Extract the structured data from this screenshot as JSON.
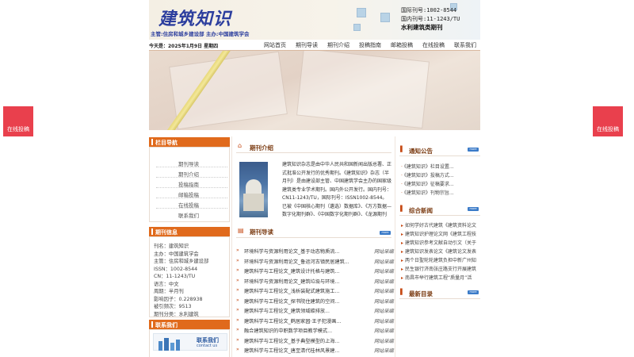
{
  "header": {
    "logo_title": "建筑知识",
    "logo_sub": "主管:住房和城乡建设部 主办:中国建筑学会",
    "issn_intl": "国际刊号:1002-8544",
    "issn_cn": "国内刊号:11-1243/TU",
    "category": "水利建筑类期刊"
  },
  "navbar": {
    "date": "今天是：2025年1月9日 星期四",
    "items": [
      "网站首页",
      "期刊导读",
      "期刊介绍",
      "投稿指南",
      "邮箱投稿",
      "在线投稿",
      "联系我们"
    ]
  },
  "float": {
    "left_label": "在线投稿",
    "right_label": "在线投稿"
  },
  "sidebar": {
    "nav_title": "栏目导航",
    "nav_items": [
      "期刊导读",
      "期刊介绍",
      "投稿指南",
      "邮箱投稿",
      "在线投稿",
      "联系我们"
    ],
    "info_title": "期刊信息",
    "info_lines": [
      "刊名：建筑知识",
      "主办：中国建筑学会",
      "主管：住房和城乡建设部",
      "ISSN：1002-8544",
      "CN：11-1243/TU",
      "语言：中文",
      "周期：半月刊",
      "影响因子：0.228938",
      "被引频次：9513",
      "期刊分类：水利建筑"
    ],
    "contact_title": "联系我们",
    "contact_img_text": "联系我们",
    "contact_img_sub": "contact us"
  },
  "main": {
    "intro_title": "期刊介绍",
    "intro_text": "建筑知识杂志是由中华人民共和国新闻出版总署、正式批准公开发行的优秀期刊。《建筑知识》杂志（半月刊）是由建设部主管、中国建筑学会主办的国家级建筑类专业学术期刊。国内外公开发行。国内刊号：CN11-1243/TU，国际刊号：ISSN1002-8544。已被《中国核心期刊（遴选）数据库》、《万方数据—数字化期刊群》、《中国数字化期刊群》、《龙源期刊网》等全",
    "guide_title": "期刊导读",
    "more": "more",
    "articles": [
      "环境科学与资源利用论文_基于动态物质流...",
      "环境科学与资源利用论文_鲁运河古镇民居建筑...",
      "建筑科学与工程论文_建筑设计托格与建筑...",
      "环境科学与资源利用论文_建筑垃圾与环境...",
      "建筑科学与工程论文_浅析装配式建筑施工...",
      "建筑科学与工程论文_探书院住建筑的空间...",
      "建筑科学与工程论文_建筑领域碳排放...",
      "建筑科学与工程论文_鹤居家园·王子犯漫画...",
      "融合建筑知识的中职数学项目教学模式...",
      "建筑科学与工程论文_基于典型模型的上海...",
      "建筑科学与工程论文_唐至清代桂林风景建..."
    ],
    "article_source": "网站采编"
  },
  "right": {
    "notice_title": "通知公告",
    "notices": [
      "《建筑知识》栏目设置...",
      "《建筑知识》投稿方式...",
      "《建筑知识》征稿要求...",
      "《建筑知识》刊物宗旨..."
    ],
    "news_title": "综合新闻",
    "news": [
      "如何学好古代建筑《建筑资料论文",
      "建筑知识护理论文网《建筑工程技",
      "建筑知识参考文献自动引文（关于",
      "建筑知识发表论文《建筑论文发表",
      "两个日聖轮轮建筑负担中新广州知",
      "民生银行济南张庄路支行开展建筑",
      "南昌市举行建筑工程“质量月”活"
    ],
    "latest_title": "最新目录"
  }
}
